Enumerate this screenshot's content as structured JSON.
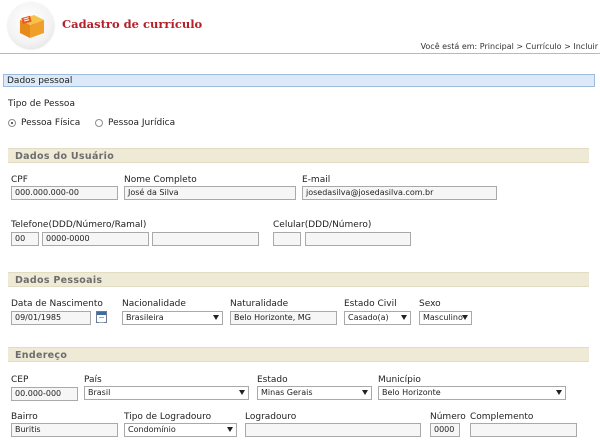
{
  "header": {
    "app_title": "Cadastro de currículo",
    "breadcrumb": "Você está em: Principal > Currículo > Incluir"
  },
  "section_pessoal": {
    "title": "Dados pessoal"
  },
  "tipo_pessoa": {
    "label": "Tipo de Pessoa",
    "options": [
      {
        "label": "Pessoa Física",
        "selected": true
      },
      {
        "label": "Pessoa Jurídica",
        "selected": false
      }
    ]
  },
  "dados_usuario": {
    "title": "Dados do Usuário",
    "cpf": {
      "label": "CPF",
      "value": "000.000.000-00"
    },
    "nome": {
      "label": "Nome Completo",
      "value": "José da Silva"
    },
    "email": {
      "label": "E-mail",
      "value": "josedasilva@josedasilva.com.br"
    },
    "telefone": {
      "label": "Telefone(DDD/Número/Ramal)",
      "ddd": "00",
      "numero": "0000-0000",
      "ramal": ""
    },
    "celular": {
      "label": "Celular(DDD/Número)",
      "ddd": "",
      "numero": ""
    }
  },
  "dados_pessoais": {
    "title": "Dados Pessoais",
    "nascimento": {
      "label": "Data de Nascimento",
      "value": "09/01/1985"
    },
    "nacionalidade": {
      "label": "Nacionalidade",
      "value": "Brasileira"
    },
    "naturalidade": {
      "label": "Naturalidade",
      "value": "Belo Horizonte, MG"
    },
    "estado_civil": {
      "label": "Estado Civil",
      "value": "Casado(a)"
    },
    "sexo": {
      "label": "Sexo",
      "value": "Masculino"
    }
  },
  "endereco": {
    "title": "Endereço",
    "cep": {
      "label": "CEP",
      "value": "00.000-000"
    },
    "pais": {
      "label": "País",
      "value": "Brasil"
    },
    "estado": {
      "label": "Estado",
      "value": "Minas Gerais"
    },
    "municipio": {
      "label": "Município",
      "value": "Belo Horizonte"
    },
    "bairro": {
      "label": "Bairro",
      "value": "Buritis"
    },
    "tipo_logradouro": {
      "label": "Tipo de Logradouro",
      "value": "Condomínio"
    },
    "logradouro": {
      "label": "Logradouro",
      "value": ""
    },
    "numero": {
      "label": "Número",
      "value": "0000"
    },
    "complemento": {
      "label": "Complemento",
      "value": ""
    }
  },
  "colors": {
    "title_red": "#b3202a",
    "section_tan": "#efead6",
    "section_blue": "#dce9f8",
    "logo_orange": "#f0a028"
  }
}
